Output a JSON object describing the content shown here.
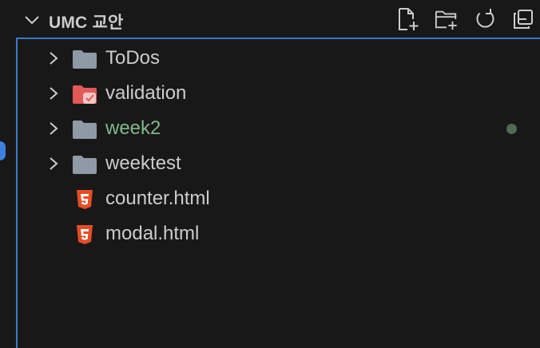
{
  "explorer": {
    "title": "UMC 교안",
    "actions": [
      {
        "name": "new-file-icon"
      },
      {
        "name": "new-folder-icon"
      },
      {
        "name": "refresh-icon"
      },
      {
        "name": "collapse-all-icon"
      }
    ]
  },
  "tree": {
    "items": [
      {
        "label": "ToDos",
        "type": "folder",
        "icon": "folder-icon"
      },
      {
        "label": "validation",
        "type": "folder",
        "icon": "folder-validation-icon"
      },
      {
        "label": "week2",
        "type": "folder",
        "icon": "folder-icon",
        "status": "modified"
      },
      {
        "label": "weektest",
        "type": "folder",
        "icon": "folder-icon"
      },
      {
        "label": "counter.html",
        "type": "file",
        "icon": "html5-icon"
      },
      {
        "label": "modal.html",
        "type": "file",
        "icon": "html5-icon"
      }
    ]
  },
  "colors": {
    "background": "#181818",
    "text": "#cccccc",
    "modified_text": "#81b88b",
    "focus_border": "#3b78c8",
    "folder": "#8e9aa6",
    "validation_folder": "#e05a5a",
    "html5": "#e44d26"
  }
}
